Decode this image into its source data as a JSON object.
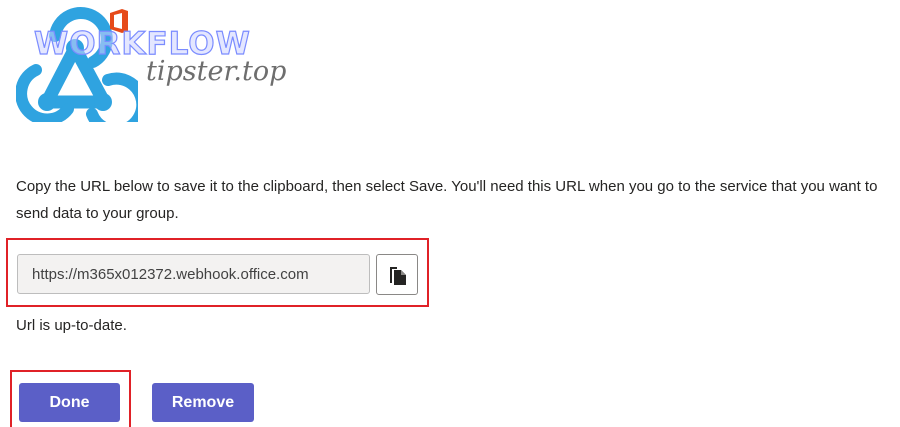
{
  "watermark": {
    "title": "WORKFLOW",
    "subtitle": "tipster.top"
  },
  "instructions": "Copy the URL below to save it to the clipboard, then select Save. You'll need this URL when you go to the service that you want to send data to your group.",
  "url_field": {
    "value": "https://m365x012372.webhook.office.com"
  },
  "status": "Url is up-to-date.",
  "buttons": {
    "done": "Done",
    "remove": "Remove"
  },
  "colors": {
    "accent": "#5b5fc7",
    "highlight": "#e02127",
    "webhook_logo": "#2fa3e0",
    "office_logo": "#e64a19"
  },
  "icons": {
    "logo": "webhook-logo-icon",
    "office": "office-icon",
    "copy": "copy-icon"
  }
}
